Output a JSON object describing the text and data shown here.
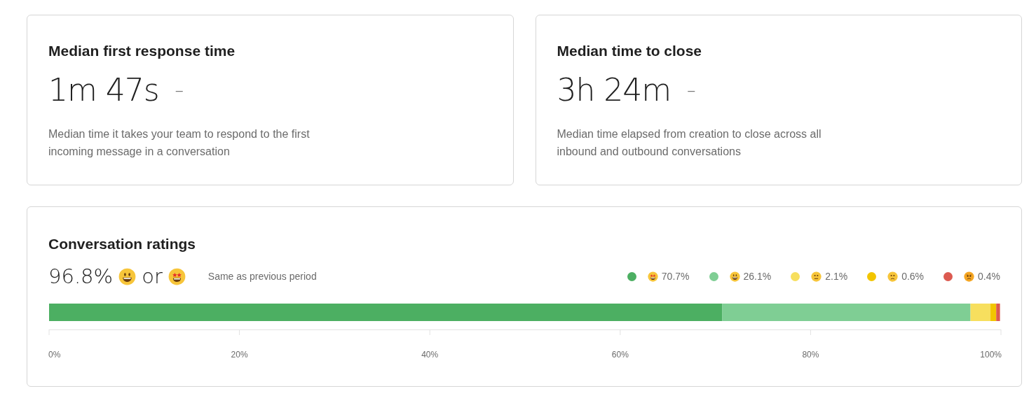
{
  "metrics": [
    {
      "title": "Median first response time",
      "value": "1m 47s",
      "change": "–",
      "description": "Median time it takes your team to respond to the first incoming message in a conversation"
    },
    {
      "title": "Median time to close",
      "value": "3h 24m",
      "change": "–",
      "description": "Median time elapsed from creation to close across all inbound and outbound conversations"
    }
  ],
  "ratings": {
    "title": "Conversation ratings",
    "headline": "96.8%",
    "connector": "or",
    "comparison": "Same as previous period",
    "legend": [
      {
        "kind": "star-struck",
        "color": "#4caf62",
        "value": "70.7%"
      },
      {
        "kind": "grinning",
        "color": "#7fce94",
        "value": "26.1%"
      },
      {
        "kind": "neutral",
        "color": "#f7df5e",
        "value": "2.1%"
      },
      {
        "kind": "frown",
        "color": "#f2c500",
        "value": "0.6%"
      },
      {
        "kind": "angry",
        "color": "#dc5a50",
        "value": "0.4%"
      }
    ],
    "chart_data": {
      "type": "bar",
      "orientation": "horizontal",
      "stacked": true,
      "xlim": [
        0,
        100
      ],
      "xticks": [
        {
          "value": 0,
          "label": "0%"
        },
        {
          "value": 20,
          "label": "20%"
        },
        {
          "value": 40,
          "label": "40%"
        },
        {
          "value": 60,
          "label": "60%"
        },
        {
          "value": 80,
          "label": "80%"
        },
        {
          "value": 100,
          "label": "100%"
        }
      ],
      "series": [
        {
          "color": "#4caf62",
          "values": [
            70.7
          ]
        },
        {
          "color": "#7fce94",
          "values": [
            26.1
          ]
        },
        {
          "color": "#f7df5e",
          "values": [
            2.1
          ]
        },
        {
          "color": "#f2c500",
          "values": [
            0.6
          ]
        },
        {
          "color": "#dc5a50",
          "values": [
            0.4
          ]
        }
      ]
    }
  }
}
